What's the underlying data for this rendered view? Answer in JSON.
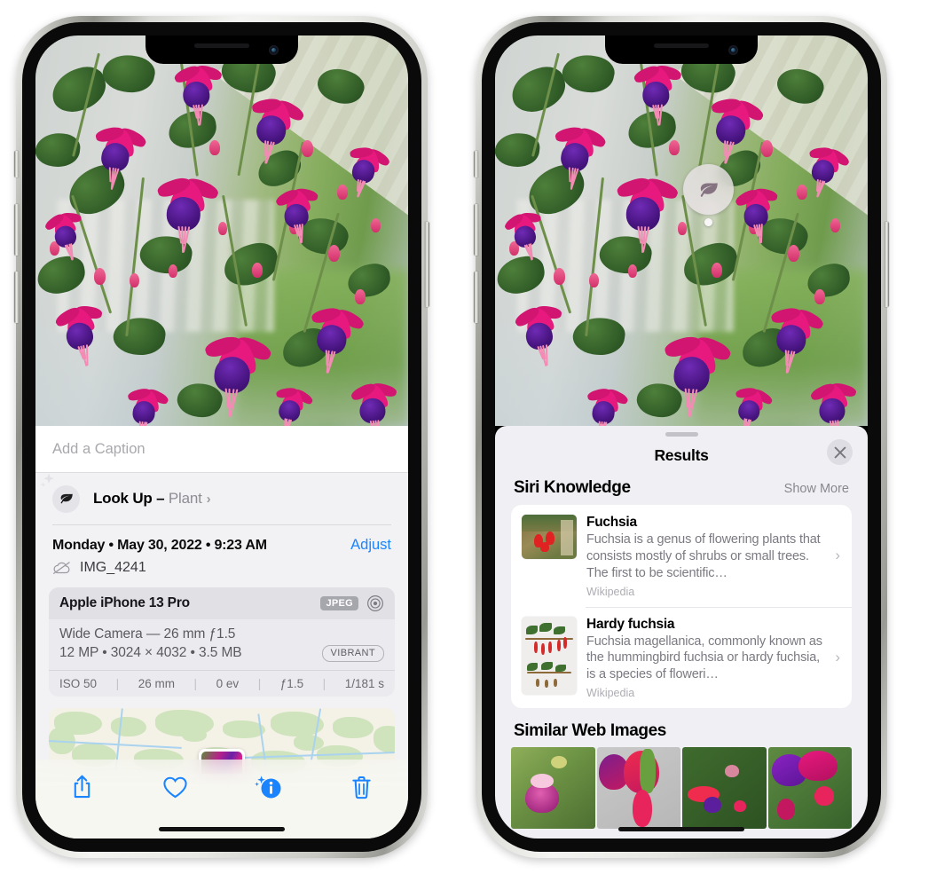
{
  "left_phone": {
    "name": "photos-info-screen",
    "caption_field": {
      "placeholder": "Add a Caption",
      "value": ""
    },
    "look_up": {
      "icon": "leaf-icon",
      "label": "Look Up",
      "dash": "–",
      "subject": "Plant",
      "chevron": "›"
    },
    "meta": {
      "date": "Monday • May 30, 2022 • 9:23 AM",
      "adjust_label": "Adjust",
      "cloud_icon": "cloud-slash-icon",
      "filename": "IMG_4241"
    },
    "exif": {
      "device": "Apple iPhone 13 Pro",
      "format_badge": "JPEG",
      "lens_icon": "aperture-icon",
      "lens_line": "Wide Camera — 26 mm ƒ1.5",
      "size_line": "12 MP • 3024 × 4032 • 3.5 MB",
      "style_badge": "VIBRANT",
      "stats": [
        "ISO 50",
        "26 mm",
        "0 ev",
        "ƒ1.5",
        "1/181 s"
      ],
      "stat_separator": "|"
    },
    "map": {
      "pin": "photo-thumbnail-pin"
    },
    "toolbar": [
      {
        "name": "share-icon",
        "label": "Share"
      },
      {
        "name": "heart-icon",
        "label": "Favorite"
      },
      {
        "name": "info-icon",
        "label": "Info"
      },
      {
        "name": "trash-icon",
        "label": "Delete"
      }
    ]
  },
  "right_phone": {
    "name": "visual-look-up-results-screen",
    "badge": {
      "icon": "leaf-icon",
      "label": "Visual Look Up"
    },
    "sheet": {
      "grabber": "sheet-grabber",
      "title": "Results",
      "close_icon": "close-icon"
    },
    "siri_knowledge": {
      "title": "Siri Knowledge",
      "show_more": "Show More",
      "cards": [
        {
          "title": "Fuchsia",
          "desc": "Fuchsia is a genus of flowering plants that consists mostly of shrubs or small trees. The first to be scientific…",
          "source": "Wikipedia",
          "thumb": "fuchsia-flowers-thumbnail",
          "chevron": "›"
        },
        {
          "title": "Hardy fuchsia",
          "desc": "Fuchsia magellanica, commonly known as the hummingbird fuchsia or hardy fuchsia, is a species of floweri…",
          "source": "Wikipedia",
          "thumb": "hardy-fuchsia-specimen-thumbnail",
          "chevron": "›"
        }
      ]
    },
    "similar_web_images": {
      "title": "Similar Web Images",
      "thumbs": [
        "fuchsia-web-image-1",
        "fuchsia-web-image-2",
        "fuchsia-web-image-3",
        "fuchsia-web-image-4"
      ]
    }
  },
  "colors": {
    "accent_blue": "#1a84ff",
    "sheet_bg": "#f2f2f5",
    "results_bg": "#f0eff4",
    "card_bg": "#ffffff",
    "secondary_text": "#7a7a82"
  }
}
